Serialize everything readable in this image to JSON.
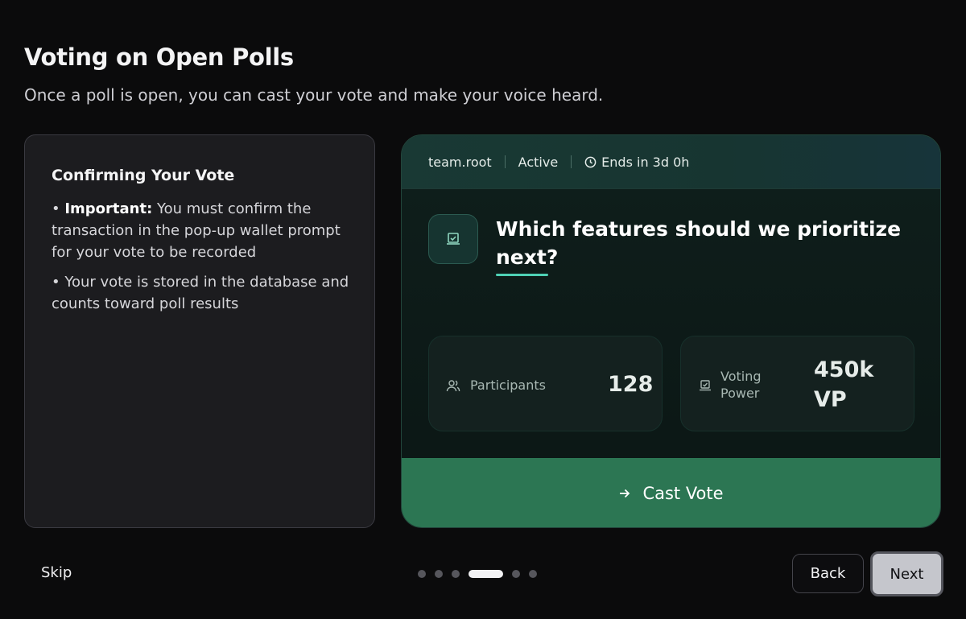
{
  "page": {
    "title": "Voting on Open Polls",
    "subtitle": "Once a poll is open, you can cast your vote and make your voice heard."
  },
  "info_panel": {
    "heading": "Confirming Your Vote",
    "items": [
      {
        "bold": "Important:",
        "text": " You must confirm the transaction in the pop-up wallet prompt for your vote to be recorded"
      },
      {
        "bold": "",
        "text": "Your vote is stored in the database and counts toward poll results"
      }
    ]
  },
  "poll": {
    "team": "team.root",
    "status": "Active",
    "ends": "Ends in 3d 0h",
    "question": "Which features should we prioritize next?",
    "stats": {
      "participants_label": "Participants",
      "participants_value": "128",
      "power_label": "Voting Power",
      "power_value": "450k VP"
    },
    "cast_button_label": "Cast Vote"
  },
  "footer": {
    "skip_label": "Skip",
    "back_label": "Back",
    "next_label": "Next",
    "steps_total": 6,
    "current_step": 4
  },
  "colors": {
    "accent_green": "#2c7653",
    "underline_teal": "#4fd1b5"
  }
}
